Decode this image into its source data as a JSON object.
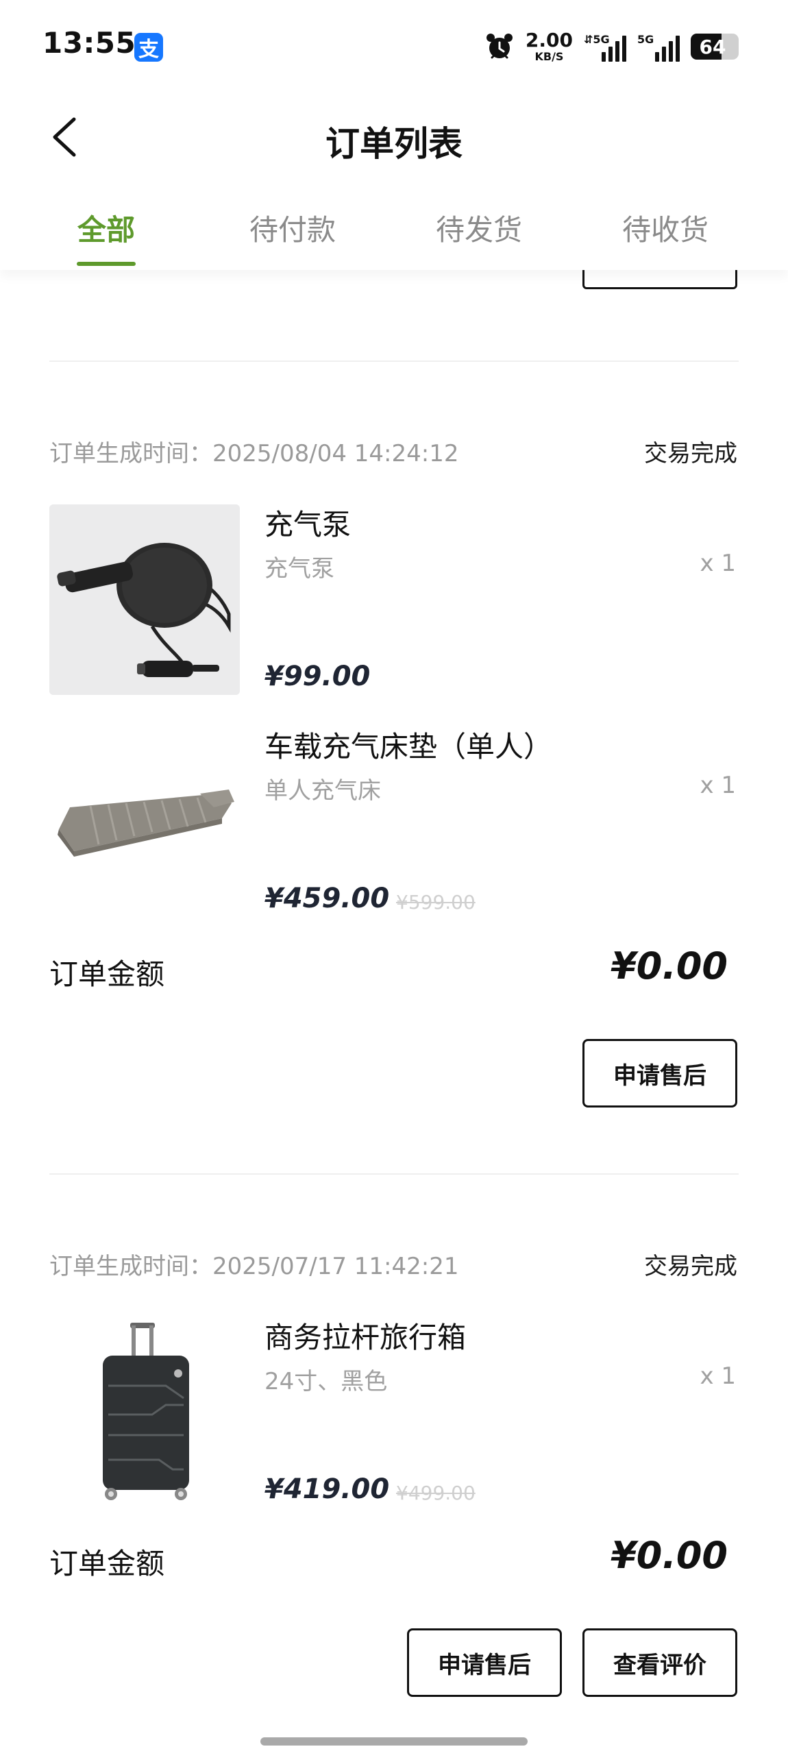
{
  "status_bar": {
    "time": "13:55",
    "app_badge": "支",
    "net_speed": "2.00",
    "net_speed_unit": "KB/S",
    "sim1_label": "⇵5G",
    "sim2_label": "5G",
    "battery": "64",
    "icons": [
      "alipay-icon",
      "alarm-icon",
      "signal-icon",
      "battery-icon"
    ]
  },
  "nav": {
    "title": "订单列表",
    "back_icon": "chevron-left-icon"
  },
  "tabs": [
    {
      "label": "全部",
      "active": true
    },
    {
      "label": "待付款",
      "active": false
    },
    {
      "label": "待发货",
      "active": false
    },
    {
      "label": "待收货",
      "active": false
    }
  ],
  "colors": {
    "accent": "#5e9a2c",
    "price": "#1f2533",
    "muted": "#9a9a9a"
  },
  "orders": [
    {
      "meta": "订单生成时间：2025/08/04 14:24:12",
      "status": "交易完成",
      "items": [
        {
          "name": "充气泵",
          "spec": "充气泵",
          "qty": "x 1",
          "price": "¥99.00",
          "original_price": ""
        },
        {
          "name": "车载充气床垫（单人）",
          "spec": "单人充气床",
          "qty": "x 1",
          "price": "¥459.00",
          "original_price": "¥599.00"
        }
      ],
      "amount_label": "订单金额",
      "amount": "¥0.00",
      "buttons": [
        "申请售后"
      ]
    },
    {
      "meta": "订单生成时间：2025/07/17 11:42:21",
      "status": "交易完成",
      "items": [
        {
          "name": "商务拉杆旅行箱",
          "spec": "24寸、黑色",
          "qty": "x 1",
          "price": "¥419.00",
          "original_price": "¥499.00"
        }
      ],
      "amount_label": "订单金额",
      "amount": "¥0.00",
      "buttons": [
        "申请售后",
        "查看评价"
      ]
    }
  ]
}
